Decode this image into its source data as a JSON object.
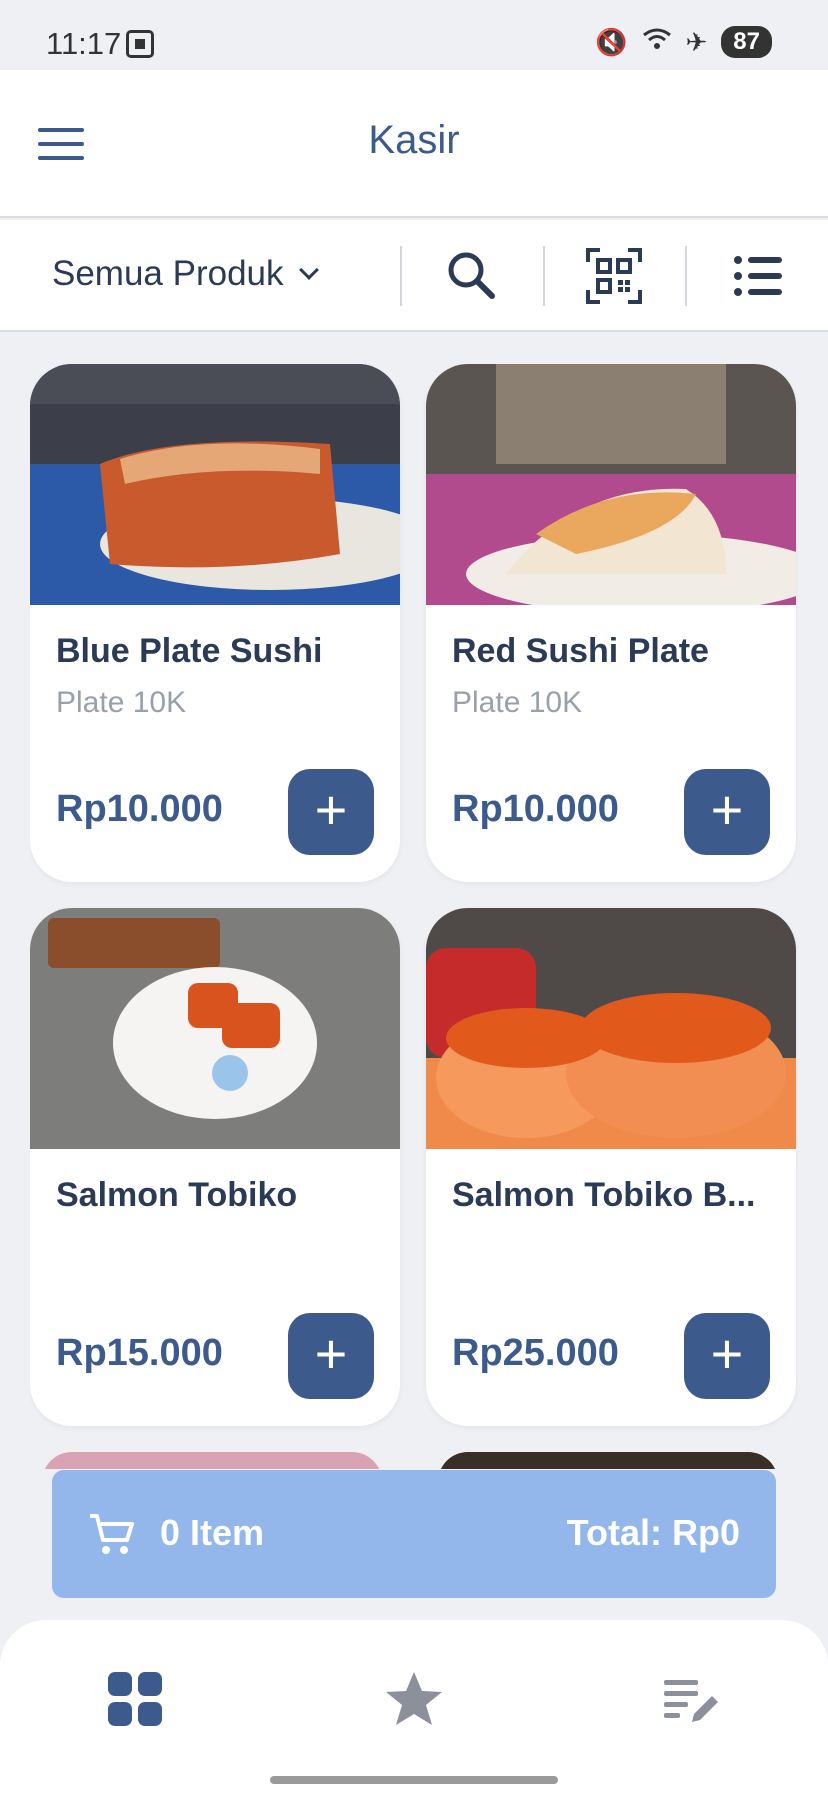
{
  "status_bar": {
    "time": "11:17",
    "battery": "87"
  },
  "app_bar": {
    "title": "Kasir"
  },
  "toolbar": {
    "category": "Semua Produk"
  },
  "products": [
    {
      "name": "Blue Plate Sushi",
      "subtitle": "Plate 10K",
      "price": "Rp10.000",
      "add": "+"
    },
    {
      "name": "Red Sushi Plate",
      "subtitle": "Plate 10K",
      "price": "Rp10.000",
      "add": "+"
    },
    {
      "name": "Salmon Tobiko",
      "subtitle": "",
      "price": "Rp15.000",
      "add": "+"
    },
    {
      "name": "Salmon Tobiko B...",
      "subtitle": "",
      "price": "Rp25.000",
      "add": "+"
    }
  ],
  "cart": {
    "items": "0 Item",
    "total": "Total: Rp0"
  },
  "colors": {
    "primary": "#3d5a8c",
    "cart_bg": "#93b7ea",
    "background": "#eef0f4"
  },
  "icons": [
    "menu-icon",
    "chevron-down-icon",
    "search-icon",
    "qr-scan-icon",
    "list-icon",
    "cart-icon",
    "grid-icon",
    "star-icon",
    "edit-list-icon"
  ]
}
